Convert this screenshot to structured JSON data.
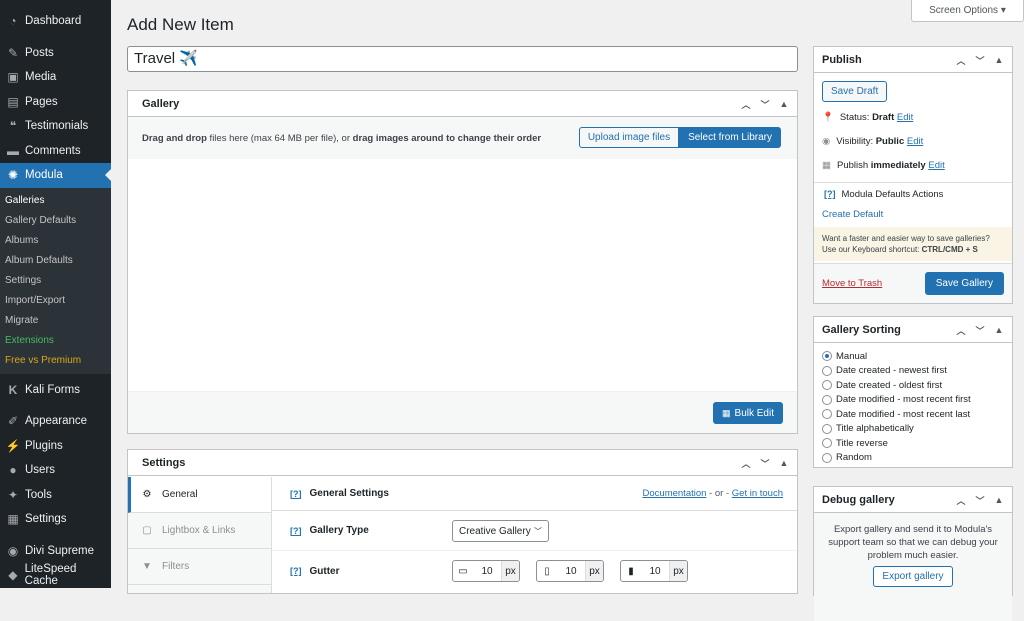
{
  "sidebar": {
    "top_items": [
      {
        "label": "Dashboard",
        "icon": "dashboard-icon"
      },
      {
        "label": "Posts",
        "icon": "pin-icon"
      },
      {
        "label": "Media",
        "icon": "media-icon"
      },
      {
        "label": "Pages",
        "icon": "page-icon"
      },
      {
        "label": "Testimonials",
        "icon": "quote-icon"
      },
      {
        "label": "Comments",
        "icon": "comment-icon"
      },
      {
        "label": "Modula",
        "icon": "modula-icon"
      }
    ],
    "submenu": [
      "Galleries",
      "Gallery Defaults",
      "Albums",
      "Album Defaults",
      "Settings",
      "Import/Export",
      "Migrate",
      "Extensions",
      "Free vs Premium"
    ],
    "bottom_items": [
      {
        "label": "Kali Forms",
        "icon": "k-icon"
      },
      {
        "label": "Appearance",
        "icon": "brush-icon"
      },
      {
        "label": "Plugins",
        "icon": "plugin-icon"
      },
      {
        "label": "Users",
        "icon": "user-icon"
      },
      {
        "label": "Tools",
        "icon": "wrench-icon"
      },
      {
        "label": "Settings",
        "icon": "settings-icon"
      },
      {
        "label": "Divi Supreme",
        "icon": "divi-icon"
      },
      {
        "label": "LiteSpeed Cache",
        "icon": "litespeed-icon"
      }
    ]
  },
  "header": {
    "title": "Add New Item",
    "screen_options": "Screen Options ▾"
  },
  "title_input": {
    "value": "Travel ✈️"
  },
  "gallery": {
    "title": "Gallery",
    "drop_text_bold1": "Drag and drop",
    "drop_text_mid": " files here (max 64 MB per file), or ",
    "drop_text_bold2": "drag images around to change their order",
    "upload_btn": "Upload image files",
    "library_btn": "Select from Library",
    "bulk_edit": "Bulk Edit"
  },
  "settings": {
    "title": "Settings",
    "tabs": [
      {
        "label": "General",
        "icon": "gear-icon"
      },
      {
        "label": "Lightbox & Links",
        "icon": "lightbox-icon"
      },
      {
        "label": "Filters",
        "icon": "filter-icon"
      }
    ],
    "q": "[?]",
    "general_settings": "General Settings",
    "documentation": "Documentation",
    "or": " - or - ",
    "get_in_touch": "Get in touch",
    "gallery_type_label": "Gallery Type",
    "gallery_type_value": "Creative Gallery",
    "gutter_label": "Gutter",
    "gutter": [
      {
        "icon": "desktop-icon",
        "value": "10",
        "unit": "px"
      },
      {
        "icon": "tablet-icon",
        "value": "10",
        "unit": "px"
      },
      {
        "icon": "mobile-icon",
        "value": "10",
        "unit": "px"
      }
    ]
  },
  "publish": {
    "title": "Publish",
    "save_draft": "Save Draft",
    "status_label": "Status: ",
    "status_value": "Draft",
    "visibility_label": "Visibility: ",
    "visibility_value": "Public",
    "publish_label": "Publish ",
    "publish_value": "immediately",
    "edit": "Edit",
    "defaults_q": "[?]",
    "defaults_actions": "Modula Defaults Actions",
    "create_default": "Create Default",
    "tip_line1": "Want a faster and easier way to save galleries?",
    "tip_line2": "Use our Keyboard shortcut: ",
    "tip_shortcut": "CTRL/CMD + S",
    "trash": "Move to Trash",
    "save_gallery": "Save Gallery"
  },
  "sorting": {
    "title": "Gallery Sorting",
    "options": [
      "Manual",
      "Date created - newest first",
      "Date created - oldest first",
      "Date modified - most recent first",
      "Date modified - most recent last",
      "Title alphabetically",
      "Title reverse",
      "Random"
    ],
    "selected": 0
  },
  "debug": {
    "title": "Debug gallery",
    "text": "Export gallery and send it to Modula's support team so that we can debug your problem much easier.",
    "export_btn": "Export gallery"
  },
  "colors": {
    "accent": "#2271b1",
    "sidebar_bg": "#1d2327"
  }
}
